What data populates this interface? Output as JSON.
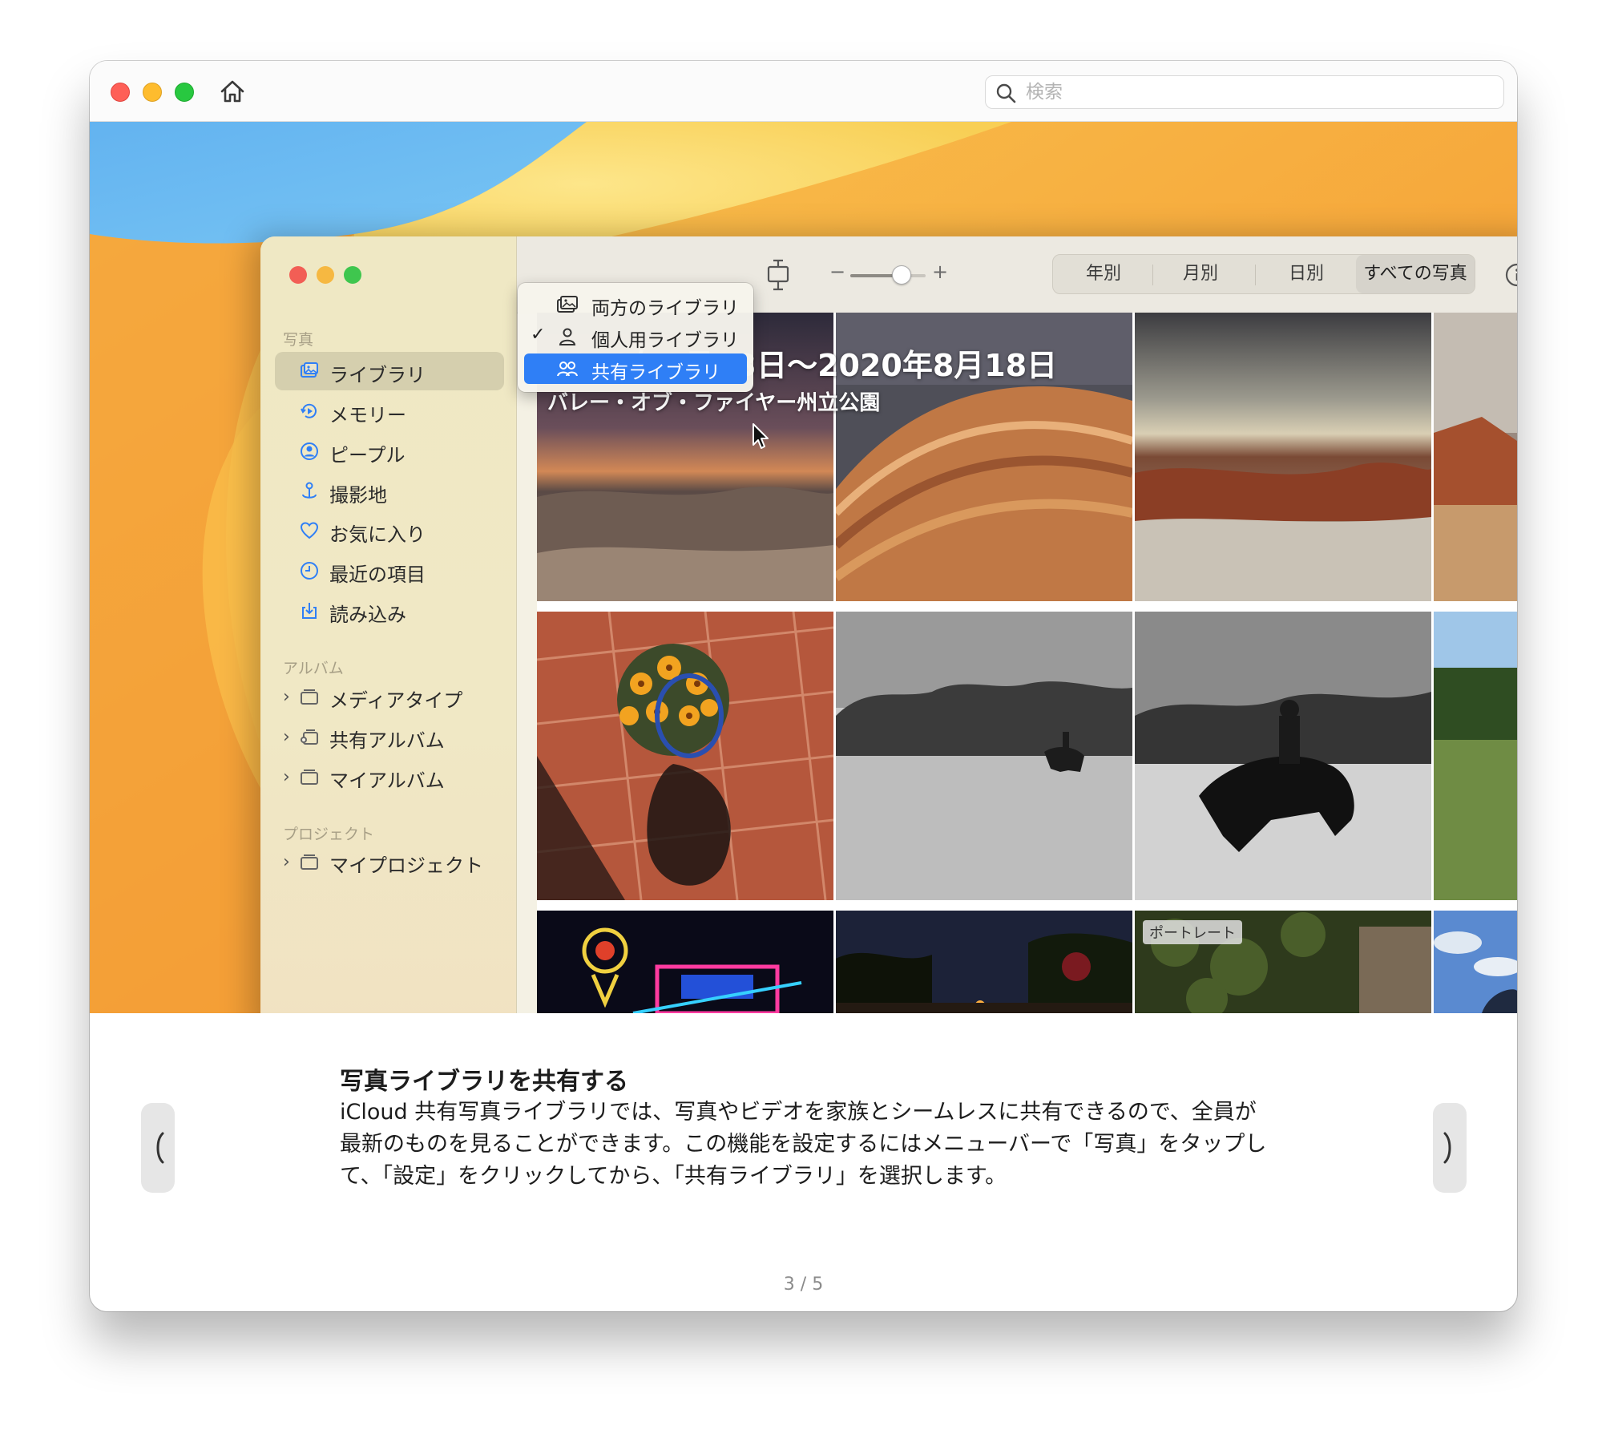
{
  "search": {
    "placeholder": "検索"
  },
  "menu": {
    "items": [
      {
        "label": "両方のライブラリ",
        "checked": false,
        "highlighted": false,
        "icon": "photo-library-icon"
      },
      {
        "label": "個人用ライブラリ",
        "checked": true,
        "highlighted": false,
        "icon": "person-icon"
      },
      {
        "label": "共有ライブラリ",
        "checked": false,
        "highlighted": true,
        "icon": "people-icon"
      }
    ],
    "check_glyph": "✓"
  },
  "sidebar": {
    "section_photos": "写真",
    "section_albums": "アルバム",
    "section_projects": "プロジェクト",
    "items": [
      {
        "label": "ライブラリ",
        "icon": "library-icon",
        "selected": true
      },
      {
        "label": "メモリー",
        "icon": "memories-icon"
      },
      {
        "label": "ピープル",
        "icon": "people-circle-icon"
      },
      {
        "label": "撮影地",
        "icon": "places-pin-icon"
      },
      {
        "label": "お気に入り",
        "icon": "heart-icon"
      },
      {
        "label": "最近の項目",
        "icon": "clock-icon"
      },
      {
        "label": "読み込み",
        "icon": "import-icon"
      }
    ],
    "albums": [
      {
        "label": "メディアタイプ",
        "icon": "album-stack-icon"
      },
      {
        "label": "共有アルバム",
        "icon": "shared-album-icon"
      },
      {
        "label": "マイアルバム",
        "icon": "album-stack-icon"
      }
    ],
    "projects": [
      {
        "label": "マイプロジェクト",
        "icon": "album-stack-icon"
      }
    ]
  },
  "toolbar": {
    "zoom_minus": "−",
    "zoom_plus": "+",
    "zoom_level": 0.68,
    "segments": [
      "年別",
      "月別",
      "日別",
      "すべての写真"
    ],
    "selected_segment": 3
  },
  "grid": {
    "date_range": "2019年9月23日〜2020年8月18日",
    "location": "バレー・オブ・ファイヤー州立公園",
    "portrait_badge": "ポートレート"
  },
  "article": {
    "title": "写真ライブラリを共有する",
    "body": "iCloud 共有写真ライブラリでは、写真やビデオを家族とシームレスに共有できるので、全員が最新のものを見ることができます。この機能を設定するにはメニューバーで「写真」をタップして、「設定」をクリックしてから、「共有ライブラリ」を選択します。"
  },
  "pager": "3 / 5"
}
